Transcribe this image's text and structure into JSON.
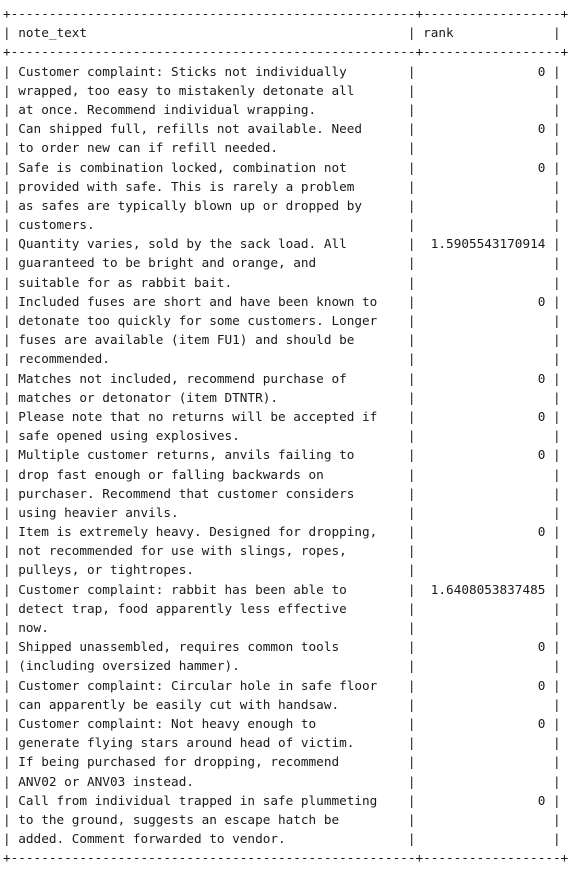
{
  "table": {
    "columns": [
      {
        "name": "note_text",
        "width": 53,
        "align": "left"
      },
      {
        "name": "rank",
        "width": 18,
        "align": "right"
      }
    ],
    "rows": [
      {
        "note_text": [
          "Customer complaint: Sticks not individually",
          "wrapped, too easy to mistakenly detonate all",
          "at once. Recommend individual wrapping."
        ],
        "rank": "0"
      },
      {
        "note_text": [
          "Can shipped full, refills not available. Need",
          "to order new can if refill needed."
        ],
        "rank": "0"
      },
      {
        "note_text": [
          "Safe is combination locked, combination not",
          "provided with safe. This is rarely a problem",
          "as safes are typically blown up or dropped by",
          "customers."
        ],
        "rank": "0"
      },
      {
        "note_text": [
          "Quantity varies, sold by the sack load. All",
          "guaranteed to be bright and orange, and",
          "suitable for as rabbit bait."
        ],
        "rank": "1.5905543170914"
      },
      {
        "note_text": [
          "Included fuses are short and have been known to",
          "detonate too quickly for some customers. Longer",
          "fuses are available (item FU1) and should be",
          "recommended."
        ],
        "rank": "0"
      },
      {
        "note_text": [
          "Matches not included, recommend purchase of",
          "matches or detonator (item DTNTR)."
        ],
        "rank": "0"
      },
      {
        "note_text": [
          "Please note that no returns will be accepted if",
          "safe opened using explosives."
        ],
        "rank": "0"
      },
      {
        "note_text": [
          "Multiple customer returns, anvils failing to",
          "drop fast enough or falling backwards on",
          "purchaser. Recommend that customer considers",
          "using heavier anvils."
        ],
        "rank": "0"
      },
      {
        "note_text": [
          "Item is extremely heavy. Designed for dropping,",
          "not recommended for use with slings, ropes,",
          "pulleys, or tightropes."
        ],
        "rank": "0"
      },
      {
        "note_text": [
          "Customer complaint: rabbit has been able to",
          "detect trap, food apparently less effective",
          "now."
        ],
        "rank": "1.6408053837485"
      },
      {
        "note_text": [
          "Shipped unassembled, requires common tools",
          "(including oversized hammer)."
        ],
        "rank": "0"
      },
      {
        "note_text": [
          "Customer complaint: Circular hole in safe floor",
          "can apparently be easily cut with handsaw."
        ],
        "rank": "0"
      },
      {
        "note_text": [
          "Customer complaint: Not heavy enough to",
          "generate flying stars around head of victim.",
          "If being purchased for dropping, recommend",
          "ANV02 or ANV03 instead."
        ],
        "rank": "0"
      },
      {
        "note_text": [
          "Call from individual trapped in safe plummeting",
          "to the ground, suggests an escape hatch be",
          "added. Comment forwarded to vendor."
        ],
        "rank": "0"
      }
    ]
  }
}
